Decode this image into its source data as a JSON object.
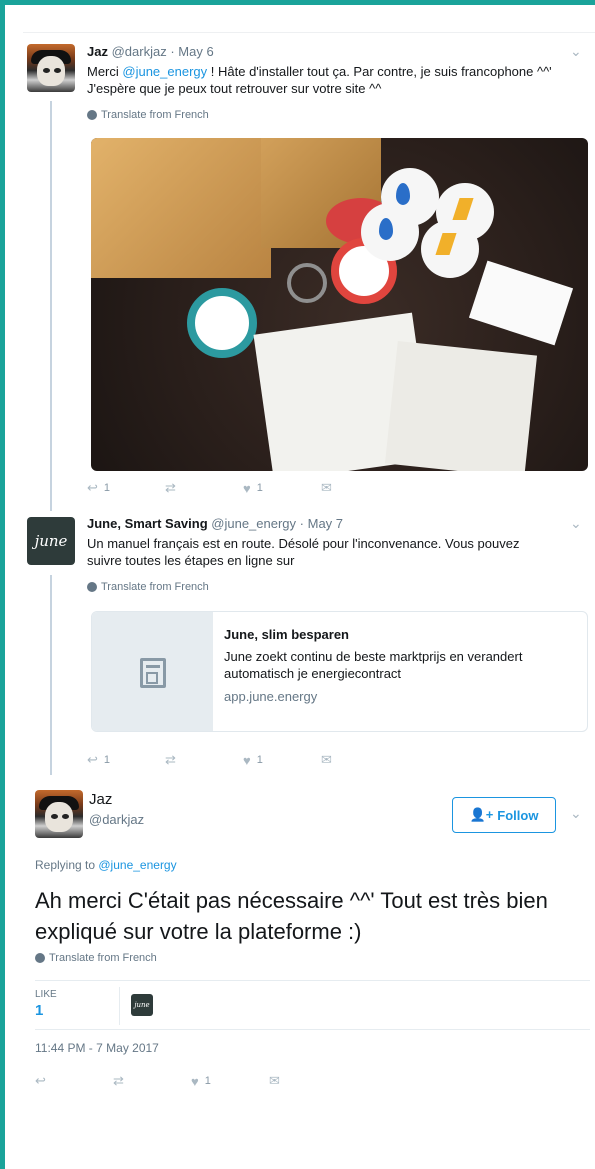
{
  "tweet1": {
    "name": "Jaz",
    "handle": "@darkjaz",
    "time": "· May 6",
    "text_before": "Merci ",
    "mention": "@june_energy",
    "text_after": " !  Hâte d'installer tout ça.  Par contre, je suis francophone ^^' J'espère que je peux tout retrouver sur votre site ^^",
    "translate": "Translate from French",
    "actions": {
      "replies": "1",
      "retweets": "",
      "likes": "1"
    }
  },
  "tweet2": {
    "name": "June, Smart Saving",
    "handle": "@june_energy",
    "time": "· May 7",
    "text": "Un manuel français est en route. Désolé pour l'inconvenance. Vous pouvez suivre toutes les étapes en ligne sur",
    "translate": "Translate from French",
    "avatar_text": "june",
    "card": {
      "title": "June, slim besparen",
      "description": "June zoekt continu de beste marktprijs en verandert automatisch je energiecontract",
      "url": "app.june.energy"
    },
    "actions": {
      "replies": "1",
      "retweets": "",
      "likes": "1"
    }
  },
  "tweet3": {
    "name": "Jaz",
    "handle": "@darkjaz",
    "follow_label": "Follow",
    "replying_prefix": "Replying to ",
    "replying_to": "@june_energy",
    "text": "Ah merci C'était pas nécessaire ^^' Tout est très bien expliqué sur votre la plateforme :)",
    "translate": "Translate from French",
    "stats": {
      "like_label": "LIKE",
      "like_count": "1",
      "liker_avatar_text": "june"
    },
    "timestamp": "11:44 PM - 7 May 2017",
    "actions": {
      "replies": "",
      "retweets": "",
      "likes": "1"
    }
  },
  "icons": {
    "reply": "reply-icon",
    "retweet": "retweet-icon",
    "like": "heart-icon",
    "dm": "envelope-icon",
    "chevron": "chevron-down-icon",
    "globe": "globe-icon",
    "follow": "add-user-icon"
  },
  "colors": {
    "accent": "#1b95e0",
    "frame": "#1aa39a",
    "muted": "#657786"
  }
}
